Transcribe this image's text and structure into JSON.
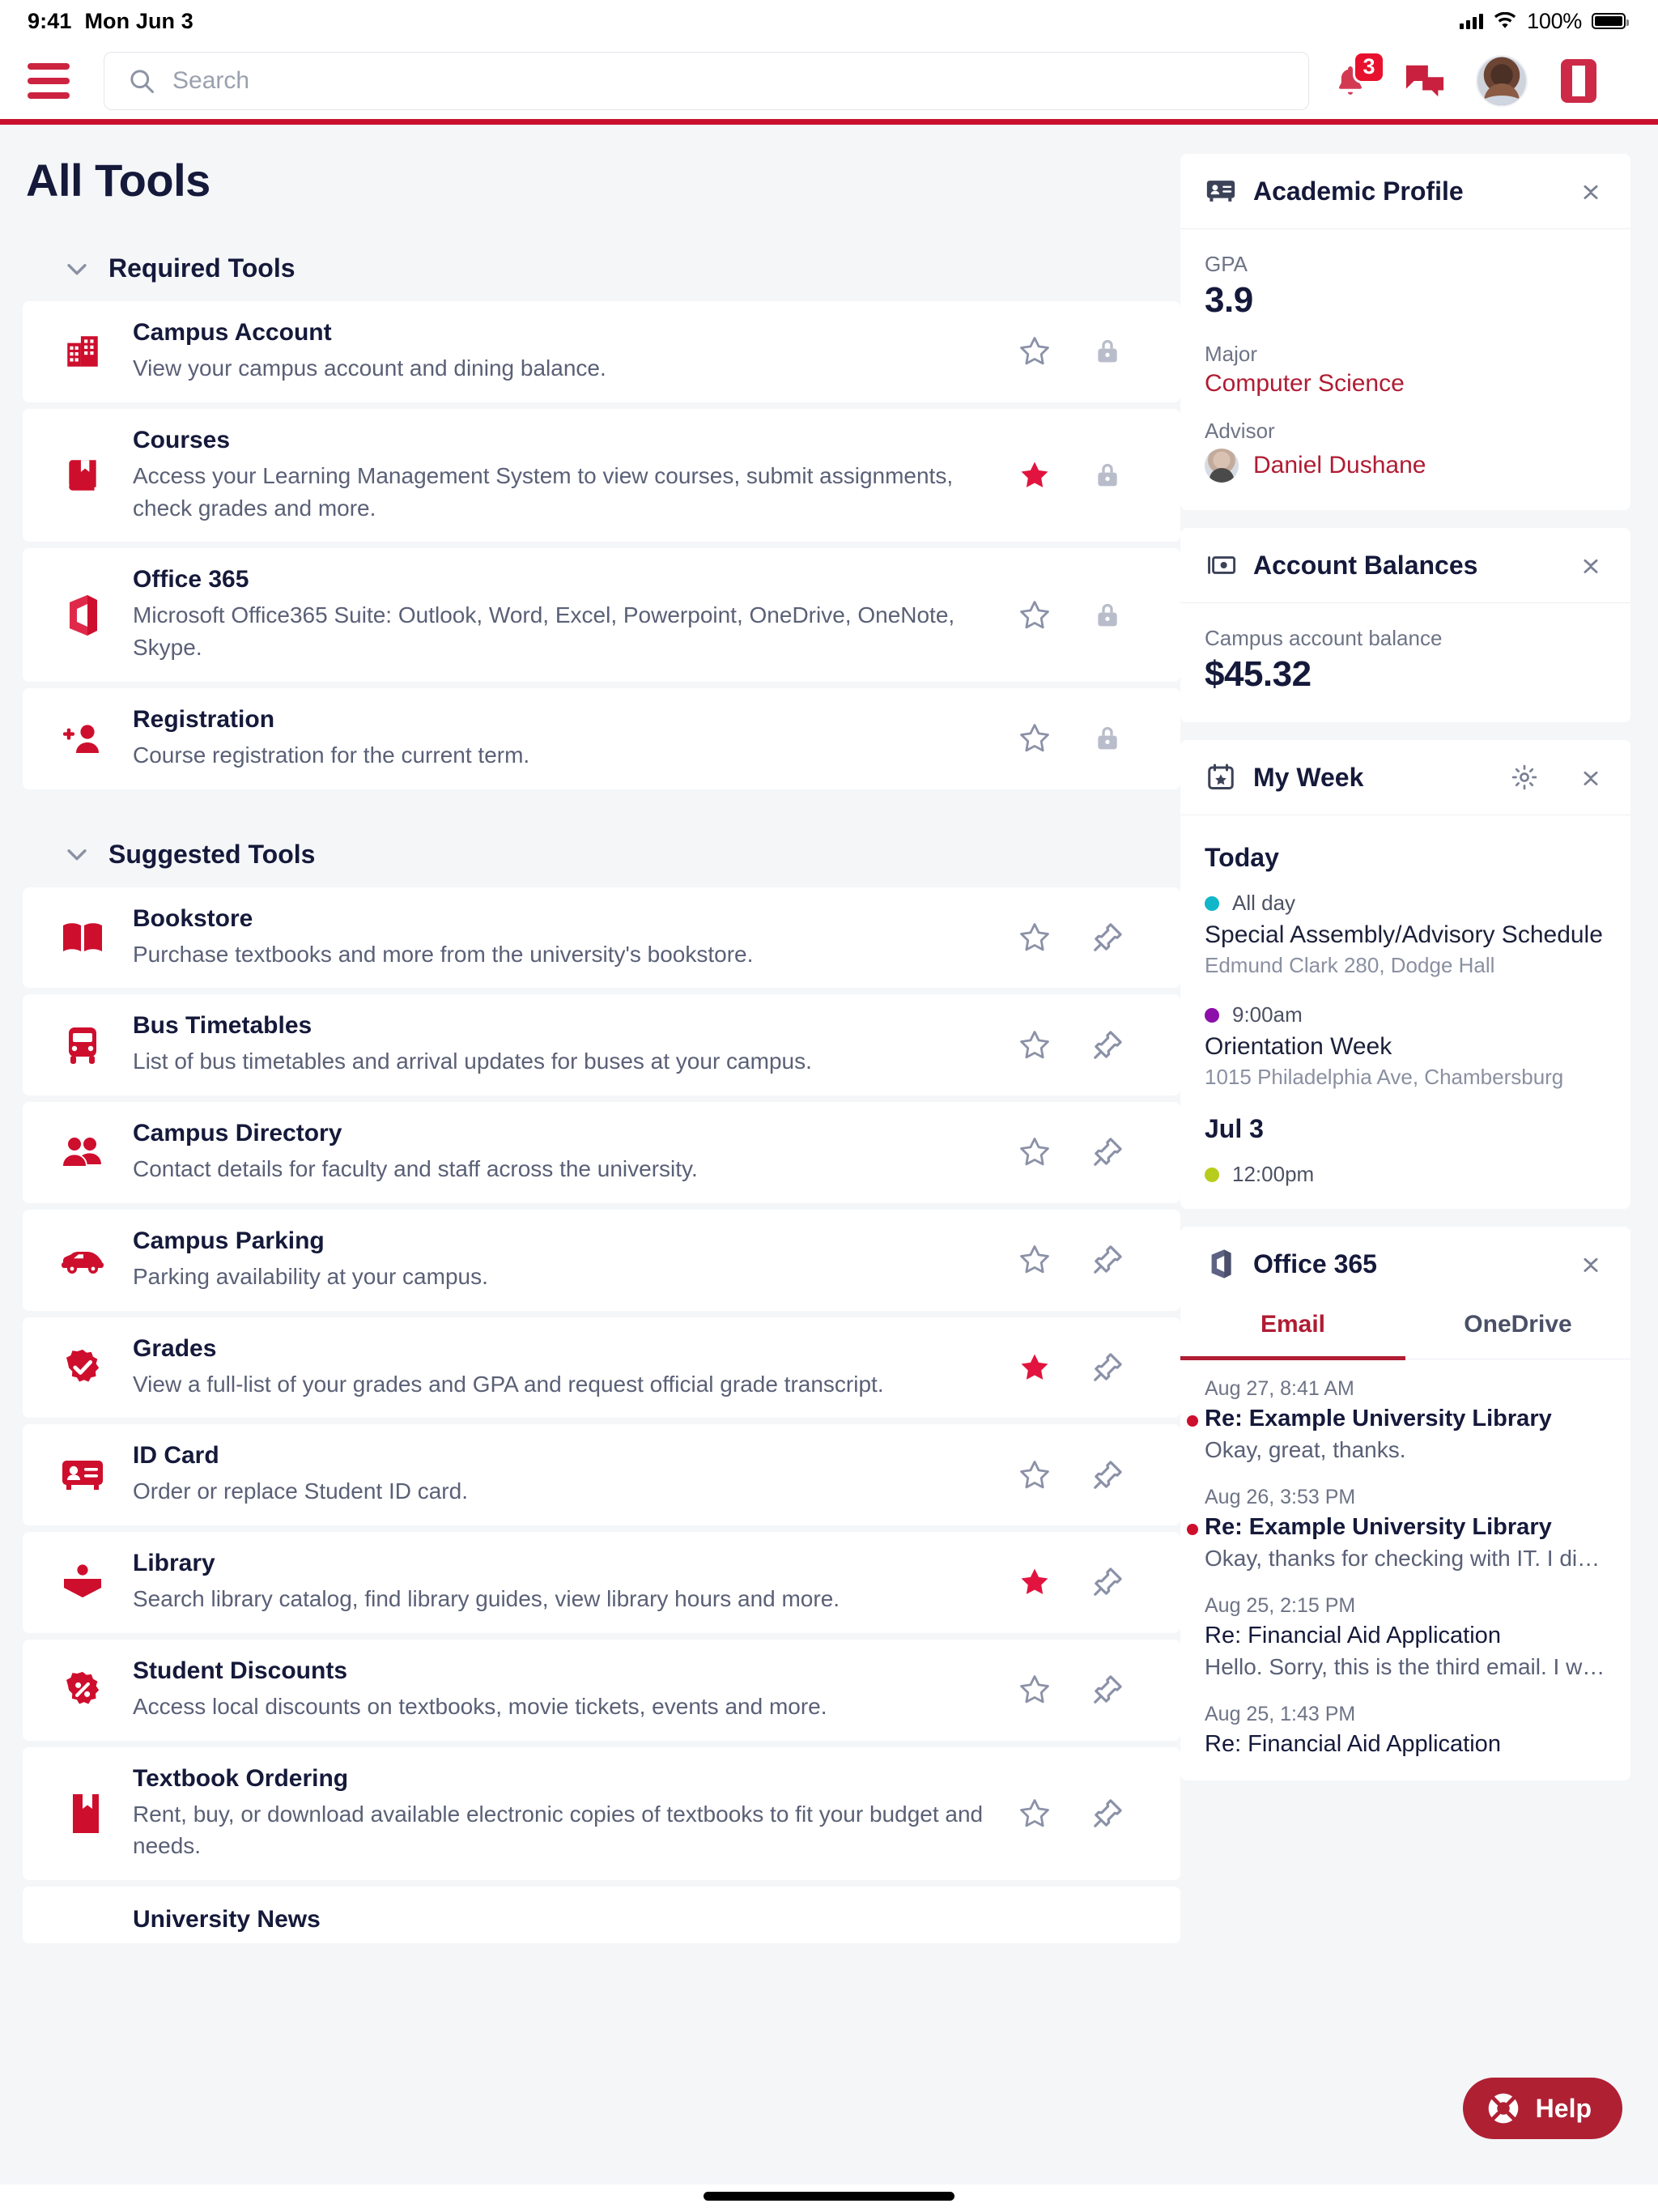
{
  "status_bar": {
    "time": "9:41",
    "date": "Mon Jun 3",
    "battery_percent": "100%",
    "signal_icon": "cellular-signal-icon",
    "wifi_icon": "wifi-icon",
    "battery_icon": "battery-icon"
  },
  "header": {
    "menu_icon": "hamburger-menu-icon",
    "search_placeholder": "Search",
    "search_value": "",
    "search_icon": "search-icon",
    "notifications_icon": "bell-icon",
    "notifications_badge": "3",
    "messages_icon": "chat-bubbles-icon",
    "avatar_icon": "user-avatar",
    "app_switcher_icon": "office-app-icon",
    "accent_color": "#C8102E"
  },
  "page": {
    "title": "All Tools"
  },
  "groups": [
    {
      "label": "Required Tools",
      "collapse_icon": "chevron-down-icon",
      "tools": [
        {
          "name": "Campus Account",
          "description": "View your campus account and dining balance.",
          "icon": "building-icon",
          "starred": false,
          "lock_icon": "lock-icon",
          "pin_icon": null
        },
        {
          "name": "Courses",
          "description": "Access your Learning Management System to view courses, submit assignments, check grades and more.",
          "icon": "book-bookmark-icon",
          "starred": true,
          "lock_icon": "lock-icon",
          "pin_icon": null
        },
        {
          "name": "Office 365",
          "description": "Microsoft Office365 Suite: Outlook, Word, Excel, Powerpoint, OneDrive, OneNote, Skype.",
          "icon": "office-icon",
          "starred": false,
          "lock_icon": "lock-icon",
          "pin_icon": null
        },
        {
          "name": "Registration",
          "description": "Course registration for the current term.",
          "icon": "person-add-icon",
          "starred": false,
          "lock_icon": "lock-icon",
          "pin_icon": null
        }
      ]
    },
    {
      "label": "Suggested Tools",
      "collapse_icon": "chevron-down-icon",
      "tools": [
        {
          "name": "Bookstore",
          "description": "Purchase textbooks and more from the university's bookstore.",
          "icon": "open-book-icon",
          "starred": false,
          "lock_icon": null,
          "pin_icon": "pin-icon"
        },
        {
          "name": "Bus Timetables",
          "description": "List of bus timetables and arrival updates for buses at your campus.",
          "icon": "bus-icon",
          "starred": false,
          "lock_icon": null,
          "pin_icon": "pin-icon"
        },
        {
          "name": "Campus Directory",
          "description": "Contact details for faculty and staff across the university.",
          "icon": "people-icon",
          "starred": false,
          "lock_icon": null,
          "pin_icon": "pin-icon"
        },
        {
          "name": "Campus Parking",
          "description": "Parking availability at your campus.",
          "icon": "car-icon",
          "starred": false,
          "lock_icon": null,
          "pin_icon": "pin-icon"
        },
        {
          "name": "Grades",
          "description": "View a full-list of your grades and GPA and request official grade transcript.",
          "icon": "badge-check-icon",
          "starred": true,
          "lock_icon": null,
          "pin_icon": "pin-icon"
        },
        {
          "name": "ID Card",
          "description": "Order or replace Student ID card.",
          "icon": "id-card-icon",
          "starred": false,
          "lock_icon": null,
          "pin_icon": "pin-icon"
        },
        {
          "name": "Library",
          "description": "Search library catalog, find library guides, view library hours and more.",
          "icon": "library-reader-icon",
          "starred": true,
          "lock_icon": null,
          "pin_icon": "pin-icon"
        },
        {
          "name": "Student Discounts",
          "description": "Access local discounts on textbooks, movie tickets, events and more.",
          "icon": "percent-badge-icon",
          "starred": false,
          "lock_icon": null,
          "pin_icon": "pin-icon"
        },
        {
          "name": "Textbook Ordering",
          "description": "Rent, buy, or download available electronic copies of textbooks to fit your budget and needs.",
          "icon": "textbook-icon",
          "starred": false,
          "lock_icon": null,
          "pin_icon": "pin-icon"
        },
        {
          "name": "University News",
          "description": "",
          "icon": "news-icon",
          "starred": false,
          "lock_icon": null,
          "pin_icon": "pin-icon"
        }
      ]
    }
  ],
  "widgets": {
    "academic_profile": {
      "title": "Academic Profile",
      "icon": "id-badge-icon",
      "collapse_icon": "collapse-icon",
      "gpa_label": "GPA",
      "gpa_value": "3.9",
      "major_label": "Major",
      "major_value": "Computer Science",
      "advisor_label": "Advisor",
      "advisor_name": "Daniel Dushane",
      "advisor_avatar_icon": "advisor-avatar"
    },
    "account_balances": {
      "title": "Account Balances",
      "icon": "money-icon",
      "collapse_icon": "collapse-icon",
      "balance_label": "Campus account balance",
      "balance_value": "$45.32"
    },
    "my_week": {
      "title": "My Week",
      "icon": "calendar-star-icon",
      "settings_icon": "gear-icon",
      "collapse_icon": "collapse-icon",
      "sections": [
        {
          "day": "Today",
          "events": [
            {
              "time": "All day",
              "dot_color": "#12B6C9",
              "name": "Special Assembly/Advisory Schedule",
              "location": "Edmund Clark 280, Dodge Hall"
            },
            {
              "time": "9:00am",
              "dot_color": "#8B0FA8",
              "name": "Orientation Week",
              "location": "1015 Philadelphia Ave, Chambersburg"
            }
          ]
        },
        {
          "day": "Jul 3",
          "events": [
            {
              "time": "12:00pm",
              "dot_color": "#B8CC1E",
              "name": "",
              "location": ""
            }
          ]
        }
      ]
    },
    "office365": {
      "title": "Office 365",
      "icon": "office-icon",
      "collapse_icon": "collapse-icon",
      "tabs": [
        {
          "label": "Email",
          "active": true
        },
        {
          "label": "OneDrive",
          "active": false
        }
      ],
      "emails": [
        {
          "date": "Aug 27, 8:41 AM",
          "subject": "Re: Example University Library",
          "snippet": "Okay, great, thanks.",
          "unread": true
        },
        {
          "date": "Aug 26, 3:53 PM",
          "subject": "Re: Example University Library",
          "snippet": "Okay, thanks for checking with IT. I di…",
          "unread": true
        },
        {
          "date": "Aug 25, 2:15 PM",
          "subject": "Re: Financial Aid Application",
          "snippet": "Hello. Sorry, this is the third email. I w…",
          "unread": false
        },
        {
          "date": "Aug 25, 1:43 PM",
          "subject": "Re: Financial Aid Application",
          "snippet": "",
          "unread": false
        }
      ]
    }
  },
  "help_button": {
    "label": "Help",
    "icon": "lifebuoy-icon",
    "color": "#AF2033"
  }
}
